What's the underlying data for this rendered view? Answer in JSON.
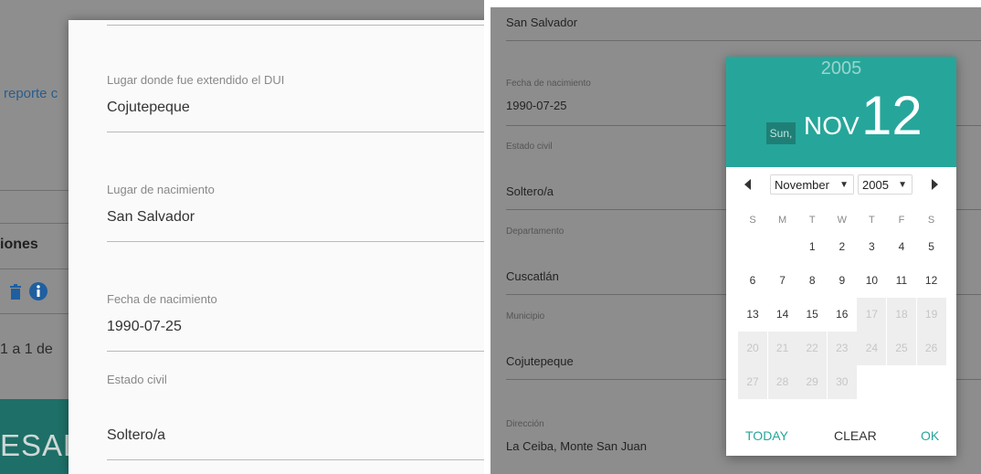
{
  "left": {
    "background": {
      "link_text": "reporte c",
      "heading": "iones",
      "count_text": "1 a 1 de",
      "footer_text": "ESALU"
    },
    "modal_fields": [
      {
        "label": "Lugar donde fue extendido el DUI",
        "value": "Cojutepeque"
      },
      {
        "label": "Lugar de nacimiento",
        "value": "San Salvador"
      },
      {
        "label": "Fecha de nacimiento",
        "value": "1990-07-25"
      },
      {
        "label": "Estado civil",
        "value": "Soltero/a"
      }
    ]
  },
  "right": {
    "top_value": "San Salvador",
    "fields": [
      {
        "label": "Fecha de nacimiento",
        "value": "1990-07-25"
      },
      {
        "label": "Estado civil",
        "value": "Soltero/a"
      },
      {
        "label": "Departamento",
        "value": "Cuscatlán"
      },
      {
        "label": "Municipio",
        "value": "Cojutepeque"
      },
      {
        "label": "Dirección",
        "value": "La Ceiba, Monte San Juan"
      }
    ]
  },
  "datepicker": {
    "year": "2005",
    "weekday": "Sun,",
    "month": "NOV",
    "day": "12",
    "month_select": "November",
    "year_select": "2005",
    "weekdays": [
      "S",
      "M",
      "T",
      "W",
      "T",
      "F",
      "S"
    ],
    "weeks": [
      [
        "",
        "",
        "1",
        "2",
        "3",
        "4",
        "5"
      ],
      [
        "6",
        "7",
        "8",
        "9",
        "10",
        "11",
        "12"
      ],
      [
        "13",
        "14",
        "15",
        "16",
        "17",
        "18",
        "19"
      ],
      [
        "20",
        "21",
        "22",
        "23",
        "24",
        "25",
        "26"
      ],
      [
        "27",
        "28",
        "29",
        "30",
        "",
        "",
        ""
      ]
    ],
    "first_disabled_day": 17,
    "today_label": "TODAY",
    "clear_label": "CLEAR",
    "ok_label": "OK",
    "accent_color": "#26a69a",
    "accent_dark": "#1f7f76"
  }
}
